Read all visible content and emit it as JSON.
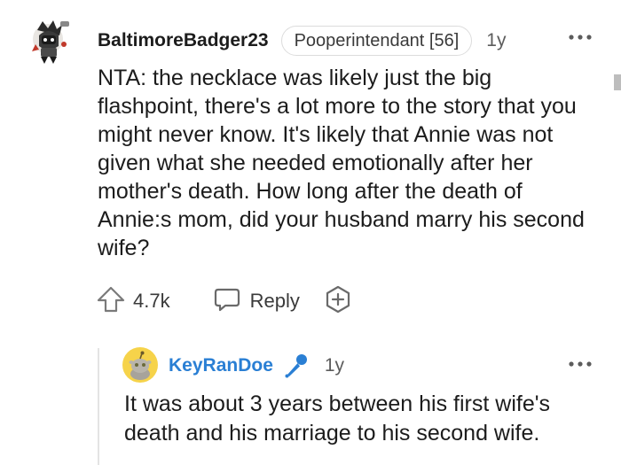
{
  "comment": {
    "username": "BaltimoreBadger23",
    "flair": "Pooperintendant [56]",
    "time": "1y",
    "body": "NTA: the necklace was likely just the big flashpoint, there's a lot more to the story that you might never know. It's likely that Annie was not given what she needed emotionally after her mother's death. How long after the death of Annie:s mom, did your husband marry his second wife?",
    "votes": "4.7k",
    "reply_label": "Reply",
    "icons": {
      "avatar": "user-avatar-icon",
      "more": "more-options-icon",
      "upvote": "upvote-arrow-icon",
      "reply": "reply-bubble-icon",
      "award": "award-plus-icon"
    }
  },
  "reply": {
    "username": "KeyRanDoe",
    "time": "1y",
    "body": "It was about 3 years between his first wife's death and his marriage to his second wife.",
    "icons": {
      "avatar": "snoo-avatar-icon",
      "badge": "microphone-icon",
      "more": "more-options-icon"
    }
  },
  "colors": {
    "reply_username": "#2a7fd4",
    "mic": "#2a7fd4",
    "avatar_bg": "#f6d34a",
    "meta_gray": "#5c5c5c",
    "thread_line": "#e4e4e4"
  }
}
